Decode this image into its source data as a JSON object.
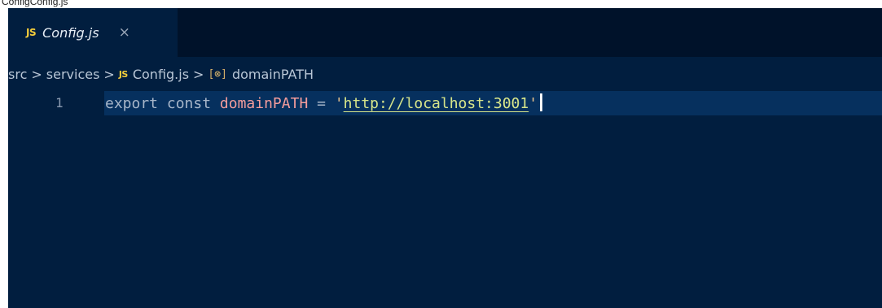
{
  "window": {
    "title": "ConfigConfig.js"
  },
  "tab": {
    "badge": "JS",
    "label": "Config.js",
    "close": "×"
  },
  "breadcrumb": {
    "items": [
      "src",
      "services",
      "Config.js",
      "domainPATH"
    ],
    "separator": ">",
    "badge": "JS",
    "variable_icon": "[⊗]"
  },
  "editor": {
    "line_number": "1",
    "tokens": {
      "keyword_export": "export",
      "keyword_const": "const",
      "identifier": "domainPATH",
      "operator": "=",
      "quote_open": "'",
      "string_value": "http://localhost:3001",
      "quote_close": "'"
    }
  },
  "colors": {
    "editor_bg": "#011e3f",
    "tabbar_bg": "#00122a",
    "line_highlight": "#06305e",
    "js_badge": "#f4cd3b",
    "identifier": "#f39c9c",
    "string": "#d7e58a"
  }
}
